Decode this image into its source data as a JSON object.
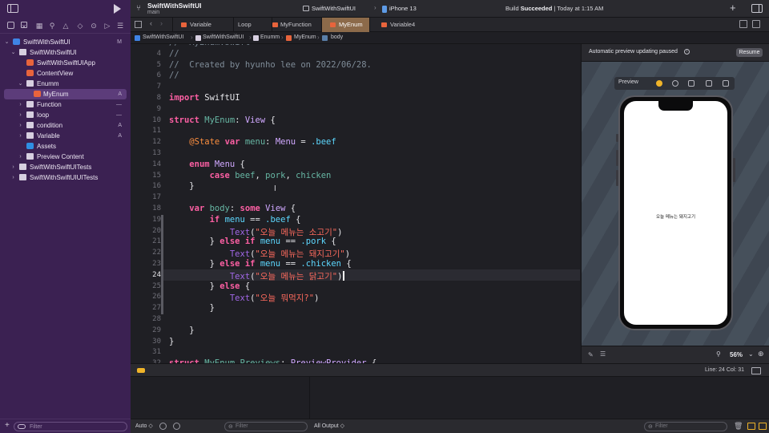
{
  "project": {
    "name": "SwiftWithSwiftUI",
    "branch": "main"
  },
  "scheme": {
    "name": "SwiftWithSwiftUI",
    "device": "iPhone 13"
  },
  "status": {
    "prefix": "Build",
    "result": "Succeeded",
    "time": "Today at 1:15 AM"
  },
  "sidebar": {
    "items": [
      {
        "label": "SwiftWithSwiftUI",
        "icon": "project-icon",
        "status": "M"
      },
      {
        "label": "SwiftWithSwiftUI",
        "icon": "folder-icon",
        "status": ""
      },
      {
        "label": "SwiftWithSwiftUIApp",
        "icon": "swift-file-icon",
        "status": ""
      },
      {
        "label": "ContentView",
        "icon": "swift-file-icon",
        "status": ""
      },
      {
        "label": "Enumm",
        "icon": "folder-icon",
        "status": ""
      },
      {
        "label": "MyEnum",
        "icon": "swift-file-icon",
        "status": "A"
      },
      {
        "label": "Function",
        "icon": "folder-icon",
        "status": "—"
      },
      {
        "label": "loop",
        "icon": "folder-icon",
        "status": "—"
      },
      {
        "label": "condition",
        "icon": "folder-icon",
        "status": "A"
      },
      {
        "label": "Variable",
        "icon": "folder-icon",
        "status": "A"
      },
      {
        "label": "Assets",
        "icon": "assets-icon",
        "status": ""
      },
      {
        "label": "Preview Content",
        "icon": "folder-icon",
        "status": ""
      },
      {
        "label": "SwiftWithSwiftUITests",
        "icon": "folder-icon",
        "status": ""
      },
      {
        "label": "SwiftWithSwiftUIUITests",
        "icon": "folder-icon",
        "status": ""
      }
    ],
    "filter_placeholder": "Filter"
  },
  "tabs": [
    {
      "label": "Variable"
    },
    {
      "label": "Loop"
    },
    {
      "label": "MyFunction"
    },
    {
      "label": "MyEnum"
    },
    {
      "label": "Variable4"
    }
  ],
  "breadcrumb": [
    "SwiftWithSwiftUI",
    "SwiftWithSwiftUI",
    "Enumm",
    "MyEnum",
    "body"
  ],
  "editor": {
    "lines": [
      {
        "n": "3",
        "text": "//  MyEnum.swift"
      },
      {
        "n": "4",
        "text": "//"
      },
      {
        "n": "5",
        "text": "//  Created by hyunho lee on 2022/06/28."
      },
      {
        "n": "6",
        "text": "//"
      },
      {
        "n": "7",
        "text": ""
      },
      {
        "n": "8",
        "text": "import SwiftUI"
      },
      {
        "n": "9",
        "text": ""
      },
      {
        "n": "10",
        "text": "struct MyEnum: View {"
      },
      {
        "n": "11",
        "text": ""
      },
      {
        "n": "12",
        "text": "    @State var menu: Menu = .beef"
      },
      {
        "n": "13",
        "text": ""
      },
      {
        "n": "14",
        "text": "    enum Menu {"
      },
      {
        "n": "15",
        "text": "        case beef, pork, chicken"
      },
      {
        "n": "16",
        "text": "    }"
      },
      {
        "n": "17",
        "text": ""
      },
      {
        "n": "18",
        "text": "    var body: some View {"
      },
      {
        "n": "19",
        "text": "        if menu == .beef {"
      },
      {
        "n": "20",
        "text": "            Text(\"오늘 메뉴는 소고기\")"
      },
      {
        "n": "21",
        "text": "        } else if menu == .pork {"
      },
      {
        "n": "22",
        "text": "            Text(\"오늘 메뉴는 돼지고기\")"
      },
      {
        "n": "23",
        "text": "        } else if menu == .chicken {"
      },
      {
        "n": "24",
        "text": "            Text(\"오늘 메뉴는 닭고기\")"
      },
      {
        "n": "25",
        "text": "        } else {"
      },
      {
        "n": "26",
        "text": "            Text(\"오늘 뭐먹지?\")"
      },
      {
        "n": "27",
        "text": "        }"
      },
      {
        "n": "28",
        "text": ""
      },
      {
        "n": "29",
        "text": "    }"
      },
      {
        "n": "30",
        "text": "}"
      },
      {
        "n": "31",
        "text": ""
      },
      {
        "n": "32",
        "text": "struct MyEnum_Previews: PreviewProvider {"
      }
    ],
    "current_line": "24"
  },
  "preview": {
    "message": "Automatic preview updating paused",
    "resume_label": "Resume",
    "toolbar_label": "Preview",
    "phone_text": "오늘 메뉴는 돼지고기",
    "zoom": "56%"
  },
  "debug": {
    "position": "Line: 24  Col: 31",
    "auto_label": "Auto ◇",
    "output_label": "All Output ◇",
    "filter_placeholder": "Filter"
  },
  "colors": {
    "sidebar_bg": "#3b2152",
    "selection": "#5c3c7a",
    "keyword": "#fc5fa3",
    "string": "#fc6a5d",
    "type": "#d0a8ff",
    "property": "#5dd8ff",
    "accent": "#f0b429"
  }
}
